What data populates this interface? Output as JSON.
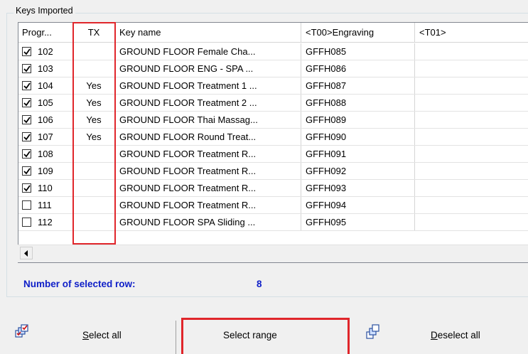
{
  "group_title": "Keys Imported",
  "columns": {
    "progr": "Progr...",
    "tx": "TX",
    "key_name": "Key name",
    "engraving": "<T00>Engraving",
    "t01": "<T01>"
  },
  "rows": [
    {
      "checked": true,
      "progr": "102",
      "tx": "",
      "key_name": "GROUND FLOOR Female Cha...",
      "engraving": "GFFH085",
      "t01": ""
    },
    {
      "checked": true,
      "progr": "103",
      "tx": "",
      "key_name": "GROUND FLOOR ENG - SPA ...",
      "engraving": "GFFH086",
      "t01": ""
    },
    {
      "checked": true,
      "progr": "104",
      "tx": "Yes",
      "key_name": "GROUND FLOOR Treatment 1 ...",
      "engraving": "GFFH087",
      "t01": ""
    },
    {
      "checked": true,
      "progr": "105",
      "tx": "Yes",
      "key_name": "GROUND FLOOR Treatment 2 ...",
      "engraving": "GFFH088",
      "t01": ""
    },
    {
      "checked": true,
      "progr": "106",
      "tx": "Yes",
      "key_name": "GROUND FLOOR Thai Massag...",
      "engraving": "GFFH089",
      "t01": ""
    },
    {
      "checked": true,
      "progr": "107",
      "tx": "Yes",
      "key_name": "GROUND FLOOR Round Treat...",
      "engraving": "GFFH090",
      "t01": ""
    },
    {
      "checked": true,
      "progr": "108",
      "tx": "",
      "key_name": "GROUND FLOOR Treatment R...",
      "engraving": "GFFH091",
      "t01": ""
    },
    {
      "checked": true,
      "progr": "109",
      "tx": "",
      "key_name": "GROUND FLOOR Treatment R...",
      "engraving": "GFFH092",
      "t01": ""
    },
    {
      "checked": true,
      "progr": "110",
      "tx": "",
      "key_name": "GROUND FLOOR Treatment R...",
      "engraving": "GFFH093",
      "t01": ""
    },
    {
      "checked": false,
      "progr": "111",
      "tx": "",
      "key_name": "GROUND FLOOR Treatment R...",
      "engraving": "GFFH094",
      "t01": ""
    },
    {
      "checked": false,
      "progr": "112",
      "tx": "",
      "key_name": "GROUND FLOOR SPA Sliding ...",
      "engraving": "GFFH095",
      "t01": ""
    }
  ],
  "selection": {
    "label": "Number of selected row:",
    "count": "8"
  },
  "buttons": {
    "select_all": {
      "mnemonic": "S",
      "rest": "elect all",
      "icon": "select-all-icon"
    },
    "select_range": {
      "label": "Select range"
    },
    "deselect_all": {
      "mnemonic": "D",
      "rest": "eselect all",
      "icon": "deselect-all-icon"
    }
  },
  "colors": {
    "highlight": "#e0262b",
    "count_text": "#1020c8"
  }
}
